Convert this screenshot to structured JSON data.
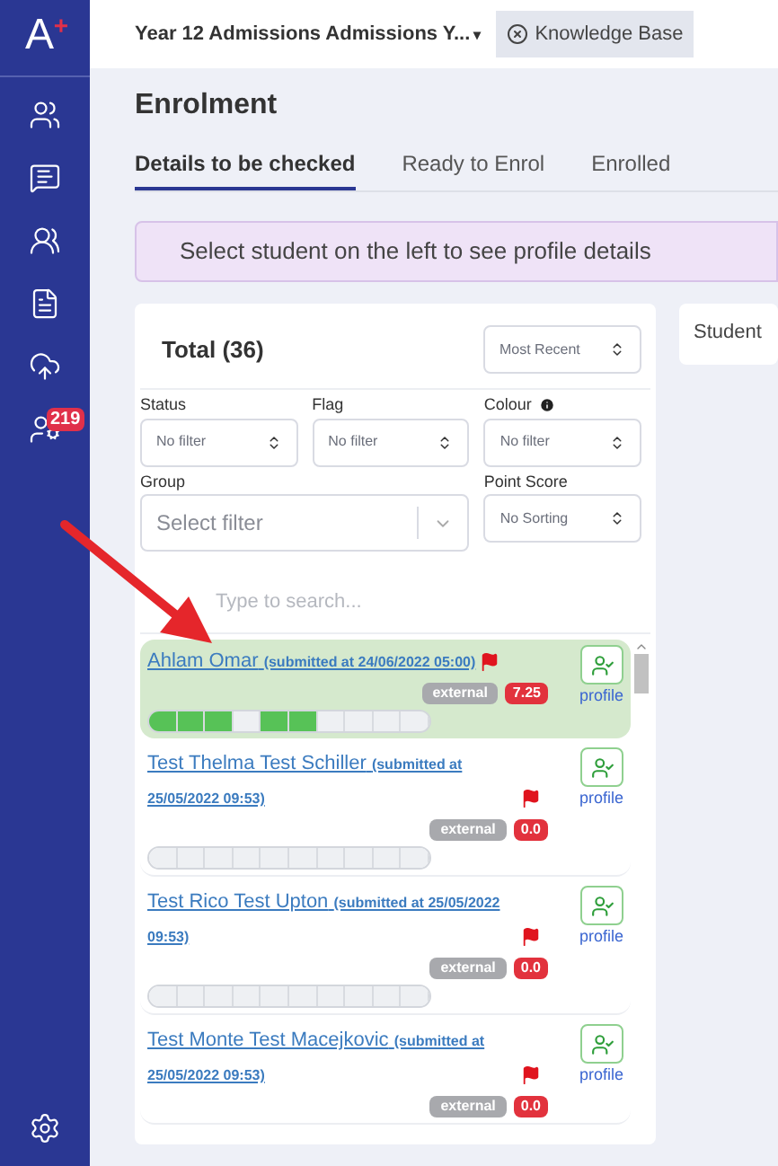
{
  "sidebar": {
    "logo": {
      "letter": "A",
      "mark": "+"
    },
    "notification_badge": "219"
  },
  "top_bar": {
    "context": "Year 12 Admissions Admissions Y...",
    "caret": "▾",
    "knowledge_base": "Knowledge Base"
  },
  "page_title": "Enrolment",
  "tabs": [
    {
      "label": "Details to be checked",
      "selected": true
    },
    {
      "label": "Ready to Enrol",
      "selected": false
    },
    {
      "label": "Enrolled",
      "selected": false
    }
  ],
  "banner": "Select student on the left to see profile details",
  "list_panel": {
    "total": "Total (36)",
    "sort": "Most Recent",
    "filters": [
      {
        "label": "Status",
        "value": "No filter"
      },
      {
        "label": "Flag",
        "value": "No filter"
      },
      {
        "label": "Colour",
        "value": "No filter",
        "info": true
      }
    ],
    "group": {
      "label": "Group",
      "placeholder": "Select filter"
    },
    "point_score": {
      "label": "Point Score",
      "value": "No Sorting"
    },
    "search": {
      "placeholder": "Type to search..."
    },
    "students": [
      {
        "name": "Ahlam Omar",
        "submitted": "(submitted at 24/06/2022 05:00)",
        "flagged": true,
        "selected": true,
        "profile": "profile",
        "source": "external",
        "score": "7.25",
        "segments": [
          true,
          true,
          true,
          false,
          true,
          true,
          false,
          false,
          false,
          false
        ]
      },
      {
        "name": "Test Thelma Test Schiller",
        "submitted": "(submitted at 25/05/2022 09:53)",
        "flagged": true,
        "selected": false,
        "profile": "profile",
        "source": "external",
        "score": "0.0",
        "segments": [
          false,
          false,
          false,
          false,
          false,
          false,
          false,
          false,
          false,
          false
        ]
      },
      {
        "name": "Test Rico Test Upton",
        "submitted": "(submitted at 25/05/2022 09:53)",
        "flagged": true,
        "selected": false,
        "profile": "profile",
        "source": "external",
        "score": "0.0",
        "segments": [
          false,
          false,
          false,
          false,
          false,
          false,
          false,
          false,
          false,
          false
        ]
      },
      {
        "name": "Test Monte Test Macejkovic",
        "submitted": "(submitted at 25/05/2022 09:53)",
        "flagged": true,
        "selected": false,
        "profile": "profile",
        "source": "external",
        "score": "0.0"
      }
    ]
  },
  "detail_panel": {
    "heading": "Student"
  }
}
